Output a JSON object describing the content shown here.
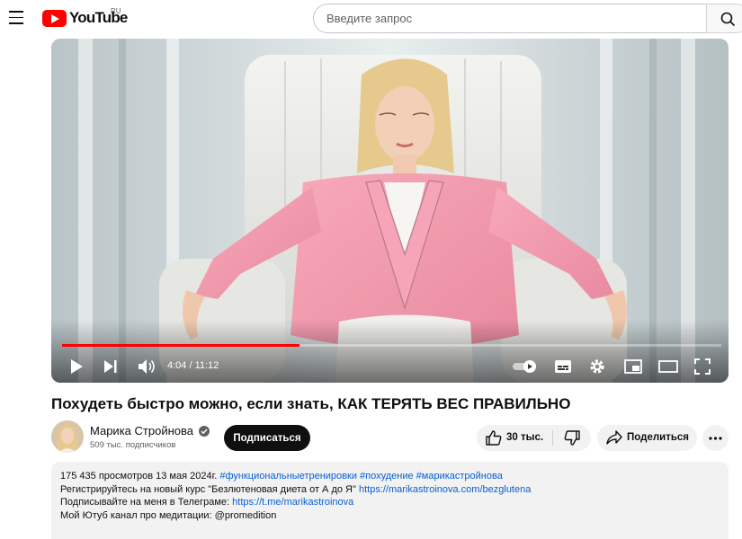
{
  "header": {
    "logo_text": "YouTube",
    "region": "RU",
    "search_placeholder": "Введите запрос"
  },
  "player": {
    "progress_fraction": 0.36,
    "time": "4:04 / 11:12"
  },
  "video": {
    "title": "Похудеть быстро можно, если знать, КАК ТЕРЯТЬ ВЕС ПРАВИЛЬНО"
  },
  "channel": {
    "name": "Марика Стройнова",
    "subscribers": "509 тыс. подписчиков",
    "subscribe_label": "Подписаться"
  },
  "actions": {
    "likes": "30 тыс.",
    "share_label": "Поделиться"
  },
  "description": {
    "meta": "175 435 просмотров  13 мая 2024г.",
    "hashtags": "#функциональныетренировки #похудение #марикастройнова",
    "line1_text": "Регистрируйтесь на новый курс \"Безлютеновая диета от А до Я\"",
    "line1_link": "https://marikastroinova.com/bezglutena",
    "line2_text": "Подписывайте на меня в Телеграме:",
    "line2_link": "https://t.me/marikastroinova",
    "line3_text": "Мой Ютуб канал про медитации: @promedition"
  },
  "colors": {
    "brand_red": "#ff0000",
    "link_blue": "#065fd4",
    "jacket_pink": "#f29aad"
  }
}
